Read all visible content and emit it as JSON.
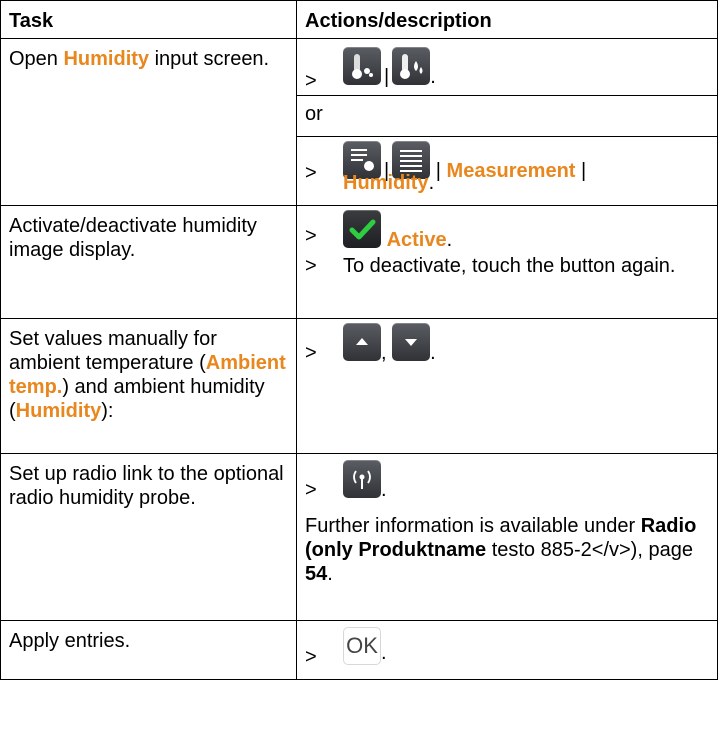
{
  "header": {
    "task": "Task",
    "actions": "Actions/description"
  },
  "rows": [
    {
      "task_parts": [
        "Open ",
        "Humidity",
        " input screen."
      ],
      "or_label": "or",
      "path": [
        "Measurement",
        " | ",
        "Humidity"
      ],
      "path_sep": "|"
    },
    {
      "task": "Activate/deactivate humidity image display.",
      "active_label": "Active",
      "deactivate": "To deactivate, touch the button again."
    },
    {
      "task_parts": [
        "Set values manually for ambient temperature (",
        "Ambient temp.",
        ") and ambient humidity (",
        "Humidity",
        "):"
      ]
    },
    {
      "task": "Set up radio link to the optional radio humidity probe.",
      "info_parts": [
        "Further information is available under ",
        "Radio (only  Produktname",
        " testo 885-2</v>), page ",
        "54",
        "."
      ]
    },
    {
      "task": "Apply entries.",
      "ok_label": "OK"
    }
  ],
  "symbols": {
    "gt": ">",
    "pipe": "|",
    "period": ".",
    "comma": ","
  },
  "colors": {
    "accent": "#E8871E",
    "button": "#3a3c40",
    "check": "#2ecc40"
  }
}
